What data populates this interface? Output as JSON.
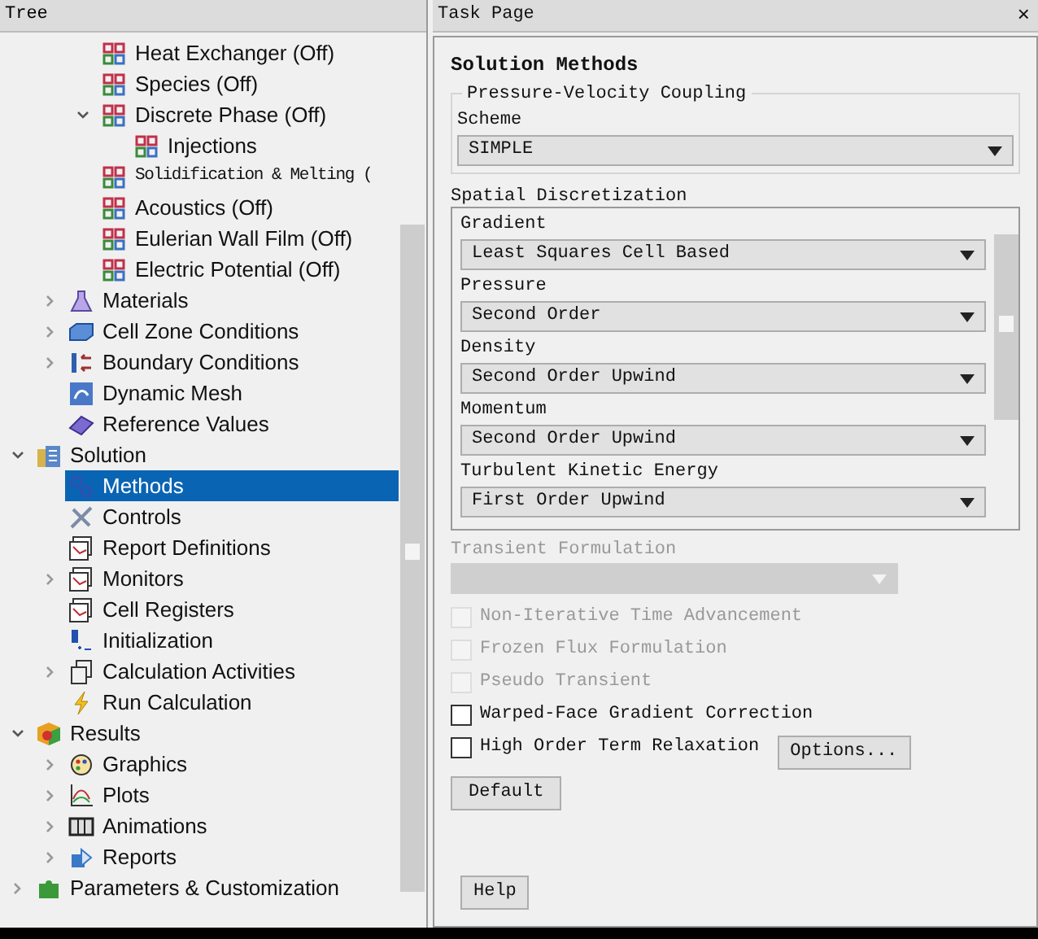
{
  "tree": {
    "title": "Tree",
    "items": [
      {
        "children": [
          {
            "children": [
              {
                "label": "Heat Exchanger (Off)",
                "kind": "model",
                "selected": false
              },
              {
                "label": "Species (Off)",
                "kind": "model",
                "selected": false
              },
              {
                "label": "Discrete Phase (Off)",
                "kind": "model",
                "selected": false,
                "expanded": true,
                "children": [
                  {
                    "label": "Injections",
                    "kind": "model",
                    "selected": false
                  }
                ]
              },
              {
                "label": "Solidification & Melting (",
                "kind": "model",
                "selected": false,
                "serif": true
              },
              {
                "label": "Acoustics (Off)",
                "kind": "model",
                "selected": false
              },
              {
                "label": "Eulerian Wall Film (Off)",
                "kind": "model",
                "selected": false
              },
              {
                "label": "Electric Potential (Off)",
                "kind": "model",
                "selected": false
              }
            ]
          },
          {
            "label": "Materials",
            "kind": "materials",
            "selected": false,
            "expanded": false
          },
          {
            "label": "Cell Zone Conditions",
            "kind": "zone",
            "selected": false,
            "expanded": false
          },
          {
            "label": "Boundary Conditions",
            "kind": "boundary",
            "selected": false,
            "expanded": false
          },
          {
            "label": "Dynamic Mesh",
            "kind": "mesh",
            "selected": false
          },
          {
            "label": "Reference Values",
            "kind": "reference",
            "selected": false
          }
        ]
      },
      {
        "label": "Solution",
        "kind": "solution",
        "selected": false,
        "expanded": true,
        "children": [
          {
            "label": "Methods",
            "kind": "methods",
            "selected": true
          },
          {
            "label": "Controls",
            "kind": "controls",
            "selected": false
          },
          {
            "label": "Report Definitions",
            "kind": "report",
            "selected": false
          },
          {
            "label": "Monitors",
            "kind": "report",
            "selected": false,
            "expanded": false
          },
          {
            "label": "Cell Registers",
            "kind": "report",
            "selected": false
          },
          {
            "label": "Initialization",
            "kind": "init",
            "selected": false
          },
          {
            "label": "Calculation Activities",
            "kind": "activities",
            "selected": false,
            "expanded": false
          },
          {
            "label": "Run Calculation",
            "kind": "run",
            "selected": false
          }
        ]
      },
      {
        "label": "Results",
        "kind": "results",
        "selected": false,
        "expanded": true,
        "children": [
          {
            "label": "Graphics",
            "kind": "graphics",
            "selected": false,
            "expanded": false
          },
          {
            "label": "Plots",
            "kind": "plots",
            "selected": false,
            "expanded": false
          },
          {
            "label": "Animations",
            "kind": "animations",
            "selected": false,
            "expanded": false
          },
          {
            "label": "Reports",
            "kind": "reports",
            "selected": false,
            "expanded": false
          }
        ]
      },
      {
        "label": "Parameters & Customization",
        "kind": "parameters",
        "selected": false,
        "expanded": false
      }
    ]
  },
  "task_page": {
    "title": "Task Page",
    "close": "×",
    "heading": "Solution Methods",
    "coupling": {
      "legend": "Pressure-Velocity Coupling",
      "label": "Scheme",
      "value": "SIMPLE"
    },
    "spatial": {
      "title": "Spatial Discretization",
      "fields": [
        {
          "label": "Gradient",
          "value": "Least Squares Cell Based"
        },
        {
          "label": "Pressure",
          "value": "Second Order"
        },
        {
          "label": "Density",
          "value": "Second Order Upwind"
        },
        {
          "label": "Momentum",
          "value": "Second Order Upwind"
        },
        {
          "label": "Turbulent Kinetic Energy",
          "value": "First Order Upwind"
        }
      ]
    },
    "transient": {
      "label": "Transient Formulation",
      "disabled": true
    },
    "options": [
      {
        "label": "Non-Iterative Time Advancement",
        "checked": false,
        "disabled": true
      },
      {
        "label": "Frozen Flux Formulation",
        "checked": false,
        "disabled": true
      },
      {
        "label": "Pseudo Transient",
        "checked": false,
        "disabled": true
      },
      {
        "label": "Warped-Face Gradient Correction",
        "checked": false,
        "disabled": false
      },
      {
        "label": "High Order Term Relaxation",
        "checked": false,
        "disabled": false,
        "button": "Options..."
      }
    ],
    "default_button": "Default",
    "help_button": "Help"
  }
}
